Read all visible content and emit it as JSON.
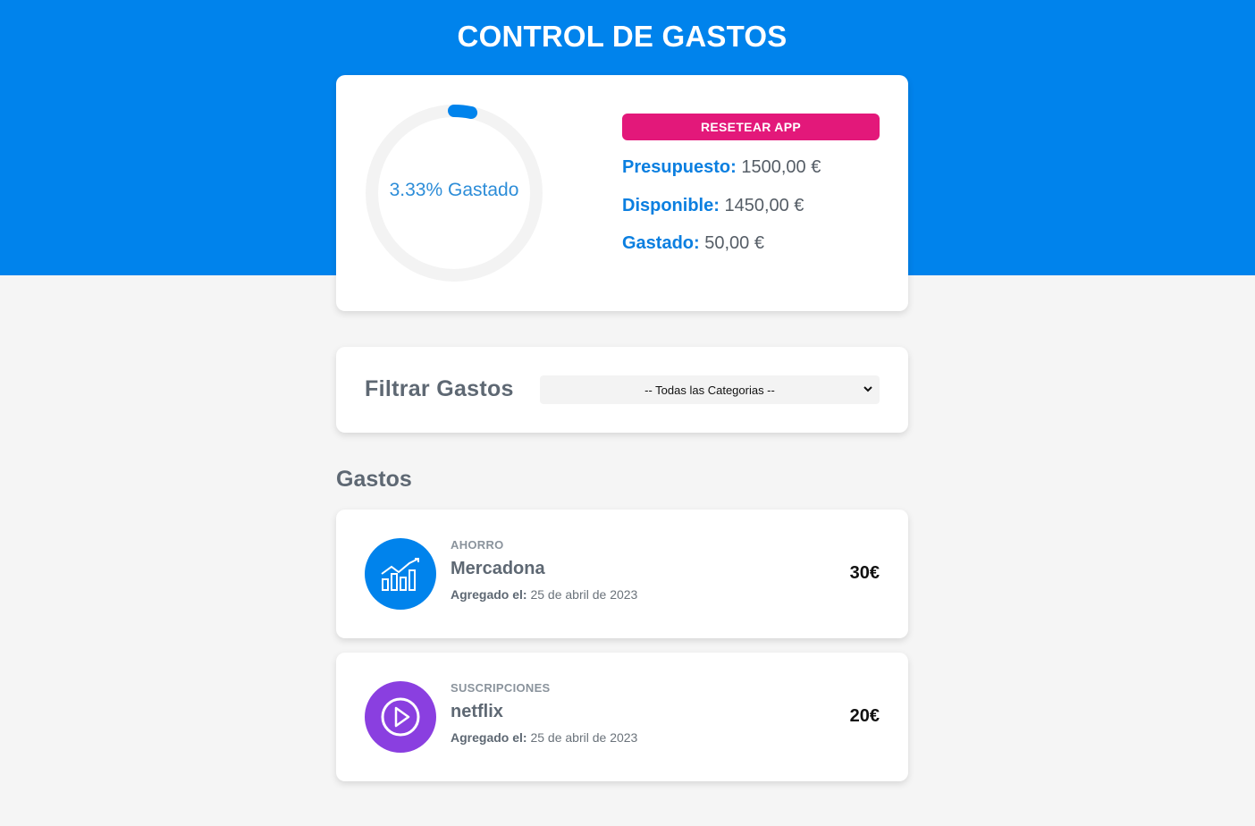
{
  "header": {
    "title": "CONTROL DE GASTOS",
    "background_color": "#0083ec"
  },
  "budget": {
    "progress_percent": 3.33,
    "progress_text": "3.33% Gastado",
    "reset_label": "RESETEAR APP",
    "reset_color": "#e3187a",
    "stats": {
      "budget_label": "Presupuesto:",
      "budget_value": "1500,00 €",
      "available_label": "Disponible:",
      "available_value": "1450,00 €",
      "spent_label": "Gastado:",
      "spent_value": "50,00 €"
    }
  },
  "filter": {
    "label": "Filtrar Gastos",
    "selected_option": "-- Todas las Categorias --"
  },
  "expenses": {
    "heading": "Gastos",
    "items": [
      {
        "category": "AHORRO",
        "name": "Mercadona",
        "date_label": "Agregado el:",
        "date_value": "25 de abril de 2023",
        "amount": "30€",
        "icon": "savings-chart-icon",
        "icon_color": "#0083ec"
      },
      {
        "category": "SUSCRIPCIONES",
        "name": "netflix",
        "date_label": "Agregado el:",
        "date_value": "25 de abril de 2023",
        "amount": "20€",
        "icon": "play-icon",
        "icon_color": "#8a3fe0"
      }
    ]
  }
}
